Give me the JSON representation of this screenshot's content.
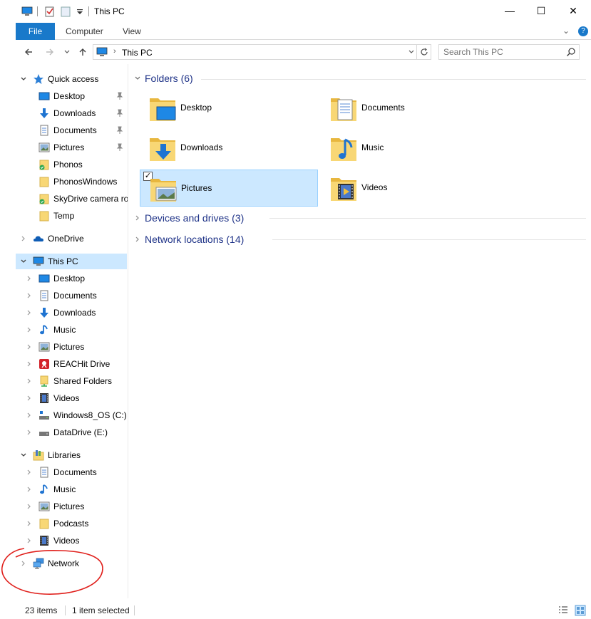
{
  "window": {
    "title": "This PC",
    "buttons": {
      "minimize": "—",
      "maximize": "☐",
      "close": "✕"
    }
  },
  "ribbon": {
    "tabs": [
      "File",
      "Computer",
      "View"
    ],
    "collapse": "⌄",
    "help": "?"
  },
  "address": {
    "path": "This PC",
    "chevron": "›",
    "search_placeholder": "Search This PC"
  },
  "sidebar": {
    "quick_access": {
      "label": "Quick access",
      "items": [
        {
          "label": "Desktop",
          "pinned": true
        },
        {
          "label": "Downloads",
          "pinned": true
        },
        {
          "label": "Documents",
          "pinned": true
        },
        {
          "label": "Pictures",
          "pinned": true
        },
        {
          "label": "Phonos",
          "pinned": false
        },
        {
          "label": "PhonosWindows",
          "pinned": false
        },
        {
          "label": "SkyDrive camera rol",
          "pinned": false
        },
        {
          "label": "Temp",
          "pinned": false
        }
      ]
    },
    "onedrive": {
      "label": "OneDrive"
    },
    "this_pc": {
      "label": "This PC",
      "items": [
        "Desktop",
        "Documents",
        "Downloads",
        "Music",
        "Pictures",
        "REACHit Drive",
        "Shared Folders",
        "Videos",
        "Windows8_OS (C:)",
        "DataDrive (E:)"
      ]
    },
    "libraries": {
      "label": "Libraries",
      "items": [
        "Documents",
        "Music",
        "Pictures",
        "Podcasts",
        "Videos"
      ]
    },
    "network": {
      "label": "Network"
    }
  },
  "content": {
    "groups": {
      "folders": "Folders (6)",
      "devices": "Devices and drives (3)",
      "network": "Network locations (14)"
    },
    "folders": [
      "Desktop",
      "Documents",
      "Downloads",
      "Music",
      "Pictures",
      "Videos"
    ],
    "selected_folder": "Pictures"
  },
  "status": {
    "count": "23 items",
    "selected": "1 item selected"
  },
  "colors": {
    "accent": "#1979ca",
    "selection": "#cce8ff",
    "group_header": "#1e3287",
    "folder_yellow": "#f8d775",
    "annotation": "#e0201c"
  }
}
